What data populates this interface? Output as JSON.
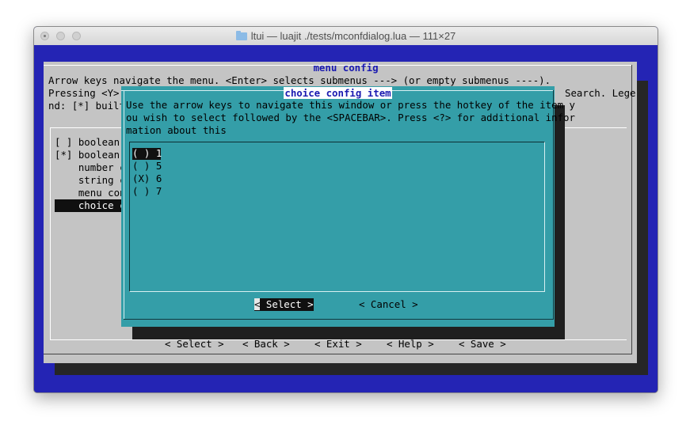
{
  "window": {
    "title": "ltui — luajit ./tests/mconfdialog.lua — 111×27"
  },
  "main_dialog": {
    "title": "menu config",
    "help_line1": "Arrow keys navigate the menu. <Enter> selects submenus ---> (or empty submenus ----).",
    "help_line2_left": "Pressing <Y>",
    "help_line2_right": "Search. Lege",
    "help_line3": "nd: [*] built",
    "menu_items": [
      {
        "text": "[ ] boolean"
      },
      {
        "text": "[*] boolean"
      },
      {
        "text": "    number c"
      },
      {
        "text": "    string c"
      },
      {
        "text": "    menu con"
      },
      {
        "text": "    choice c"
      }
    ],
    "buttons": {
      "select": "< Select >",
      "back": "< Back >",
      "exit": "< Exit >",
      "help": "< Help >",
      "save": "< Save >"
    }
  },
  "choice_dialog": {
    "title": "choice config item",
    "help_line1": "Use the arrow keys to navigate this window or press the hotkey of the item y",
    "help_line2": "ou wish to select followed by the <SPACEBAR>. Press <?> for additional infor",
    "help_line3": "mation about this",
    "options": [
      {
        "text": "( ) 1"
      },
      {
        "text": "( ) 5"
      },
      {
        "text": "(X) 6"
      },
      {
        "text": "( ) 7"
      }
    ],
    "select_button_cursor": "<",
    "select_button_rest": " Select >",
    "cancel_button": "< Cancel >"
  },
  "colors": {
    "terminal_background": "#2424b4",
    "main_dialog": "#c4c4c4",
    "choice_dialog": "#349ea8",
    "title_text": "#1a1ab0",
    "highlight": "#101010"
  }
}
